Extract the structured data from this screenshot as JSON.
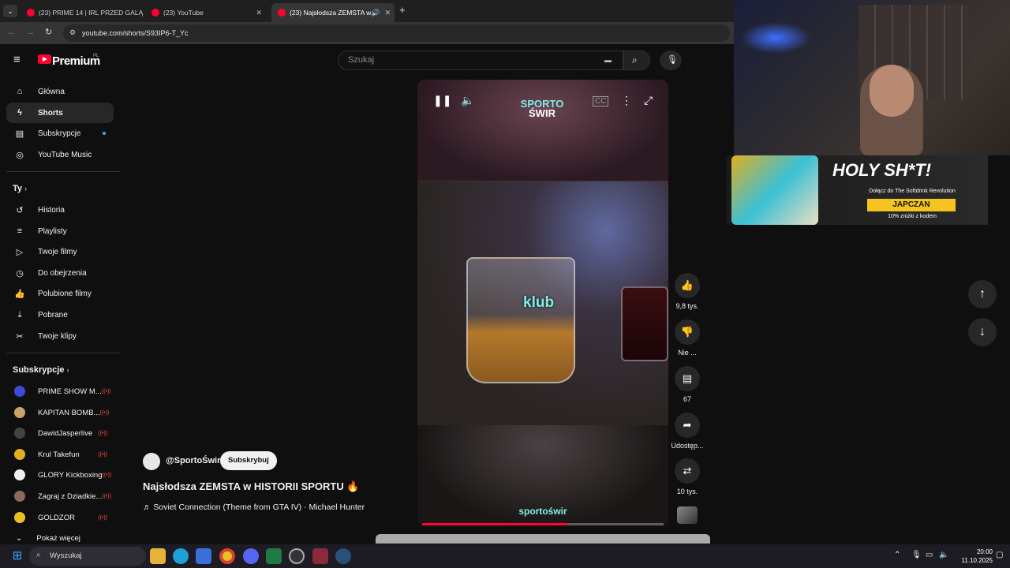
{
  "browser": {
    "tabs": [
      {
        "title": "(23) PRIME 14 | IRL PRZED GALĄ",
        "active": false
      },
      {
        "title": "(23) YouTube",
        "active": false
      },
      {
        "title": "(23) Najsłodsza ZEMSTA w",
        "active": true
      }
    ],
    "new_tab": "+",
    "url": "youtube.com/shorts/S93IP6-T_Yc"
  },
  "header": {
    "logo": "Premium",
    "region": "PL",
    "search_placeholder": "Szukaj"
  },
  "sidebar": {
    "main": [
      {
        "label": "Główna",
        "icon": "home-icon",
        "glyph": "⌂"
      },
      {
        "label": "Shorts",
        "icon": "shorts-icon",
        "glyph": "ϟ",
        "selected": true
      },
      {
        "label": "Subskrypcje",
        "icon": "subscriptions-icon",
        "glyph": "▤"
      },
      {
        "label": "YouTube Music",
        "icon": "music-icon",
        "glyph": "◎"
      }
    ],
    "you_title": "Ty",
    "you": [
      {
        "label": "Historia",
        "icon": "history-icon",
        "glyph": "↺"
      },
      {
        "label": "Playlisty",
        "icon": "playlist-icon",
        "glyph": "≡"
      },
      {
        "label": "Twoje filmy",
        "icon": "your-videos-icon",
        "glyph": "▷"
      },
      {
        "label": "Do obejrzenia",
        "icon": "watch-later-icon",
        "glyph": "◷"
      },
      {
        "label": "Polubione filmy",
        "icon": "liked-icon",
        "glyph": "👍"
      },
      {
        "label": "Pobrane",
        "icon": "download-icon",
        "glyph": "⤓"
      },
      {
        "label": "Twoje klipy",
        "icon": "clips-icon",
        "glyph": "✂"
      }
    ],
    "subs_title": "Subskrypcje",
    "subs": [
      {
        "label": "PRIME SHOW M...",
        "color": "#3b4bd8",
        "live": true
      },
      {
        "label": "KAPITAN BOMB...",
        "color": "#c8a46a",
        "live": true
      },
      {
        "label": "DawidJasperlive",
        "color": "#222222",
        "live": true
      },
      {
        "label": "Krul Takefun",
        "color": "#e0b020",
        "live": true
      },
      {
        "label": "GLORY Kickboxing",
        "color": "#f0f0f0",
        "live": true
      },
      {
        "label": "Zagraj z Dziadkie...",
        "color": "#8a6a5a",
        "live": true
      },
      {
        "label": "GOLDZOR",
        "color": "#e8c020",
        "live": true
      }
    ],
    "show_more": "Pokaż więcej",
    "live_glyph": "((•))"
  },
  "video": {
    "caption": "klub",
    "brand_top": "SPORTO",
    "brand_bottom": "ŚWIR",
    "watermark": "sportoświr",
    "progress": 0.6
  },
  "channel": {
    "name": "@SportoŚwir",
    "subscribe": "Subskrybuj",
    "title": "Najsłodsza ZEMSTA w HISTORII SPORTU 🔥",
    "music": "♬ Soviet Connection (Theme from GTA IV) · Michael Hunter"
  },
  "actions": {
    "likes": "9,8 tys.",
    "dislike": "Nie ...",
    "comments": "67",
    "share": "Udostęp...",
    "remix": "10 tys."
  },
  "ad": {
    "headline": "HOLY SH*T!",
    "sub": "Dołącz do The Softdrink Revolution",
    "code": "JAPCZAN",
    "discount": "10% zniżki z kodem"
  },
  "taskbar": {
    "search": "Wyszukaj",
    "time": "20:00",
    "date": "11.10.2025"
  }
}
